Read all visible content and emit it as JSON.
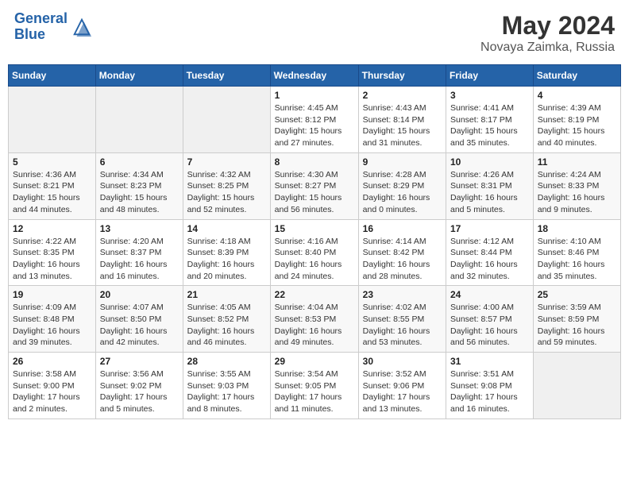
{
  "header": {
    "logo_line1": "General",
    "logo_line2": "Blue",
    "month_year": "May 2024",
    "location": "Novaya Zaimka, Russia"
  },
  "days_of_week": [
    "Sunday",
    "Monday",
    "Tuesday",
    "Wednesday",
    "Thursday",
    "Friday",
    "Saturday"
  ],
  "weeks": [
    [
      {
        "num": "",
        "info": ""
      },
      {
        "num": "",
        "info": ""
      },
      {
        "num": "",
        "info": ""
      },
      {
        "num": "1",
        "info": "Sunrise: 4:45 AM\nSunset: 8:12 PM\nDaylight: 15 hours and 27 minutes."
      },
      {
        "num": "2",
        "info": "Sunrise: 4:43 AM\nSunset: 8:14 PM\nDaylight: 15 hours and 31 minutes."
      },
      {
        "num": "3",
        "info": "Sunrise: 4:41 AM\nSunset: 8:17 PM\nDaylight: 15 hours and 35 minutes."
      },
      {
        "num": "4",
        "info": "Sunrise: 4:39 AM\nSunset: 8:19 PM\nDaylight: 15 hours and 40 minutes."
      }
    ],
    [
      {
        "num": "5",
        "info": "Sunrise: 4:36 AM\nSunset: 8:21 PM\nDaylight: 15 hours and 44 minutes."
      },
      {
        "num": "6",
        "info": "Sunrise: 4:34 AM\nSunset: 8:23 PM\nDaylight: 15 hours and 48 minutes."
      },
      {
        "num": "7",
        "info": "Sunrise: 4:32 AM\nSunset: 8:25 PM\nDaylight: 15 hours and 52 minutes."
      },
      {
        "num": "8",
        "info": "Sunrise: 4:30 AM\nSunset: 8:27 PM\nDaylight: 15 hours and 56 minutes."
      },
      {
        "num": "9",
        "info": "Sunrise: 4:28 AM\nSunset: 8:29 PM\nDaylight: 16 hours and 0 minutes."
      },
      {
        "num": "10",
        "info": "Sunrise: 4:26 AM\nSunset: 8:31 PM\nDaylight: 16 hours and 5 minutes."
      },
      {
        "num": "11",
        "info": "Sunrise: 4:24 AM\nSunset: 8:33 PM\nDaylight: 16 hours and 9 minutes."
      }
    ],
    [
      {
        "num": "12",
        "info": "Sunrise: 4:22 AM\nSunset: 8:35 PM\nDaylight: 16 hours and 13 minutes."
      },
      {
        "num": "13",
        "info": "Sunrise: 4:20 AM\nSunset: 8:37 PM\nDaylight: 16 hours and 16 minutes."
      },
      {
        "num": "14",
        "info": "Sunrise: 4:18 AM\nSunset: 8:39 PM\nDaylight: 16 hours and 20 minutes."
      },
      {
        "num": "15",
        "info": "Sunrise: 4:16 AM\nSunset: 8:40 PM\nDaylight: 16 hours and 24 minutes."
      },
      {
        "num": "16",
        "info": "Sunrise: 4:14 AM\nSunset: 8:42 PM\nDaylight: 16 hours and 28 minutes."
      },
      {
        "num": "17",
        "info": "Sunrise: 4:12 AM\nSunset: 8:44 PM\nDaylight: 16 hours and 32 minutes."
      },
      {
        "num": "18",
        "info": "Sunrise: 4:10 AM\nSunset: 8:46 PM\nDaylight: 16 hours and 35 minutes."
      }
    ],
    [
      {
        "num": "19",
        "info": "Sunrise: 4:09 AM\nSunset: 8:48 PM\nDaylight: 16 hours and 39 minutes."
      },
      {
        "num": "20",
        "info": "Sunrise: 4:07 AM\nSunset: 8:50 PM\nDaylight: 16 hours and 42 minutes."
      },
      {
        "num": "21",
        "info": "Sunrise: 4:05 AM\nSunset: 8:52 PM\nDaylight: 16 hours and 46 minutes."
      },
      {
        "num": "22",
        "info": "Sunrise: 4:04 AM\nSunset: 8:53 PM\nDaylight: 16 hours and 49 minutes."
      },
      {
        "num": "23",
        "info": "Sunrise: 4:02 AM\nSunset: 8:55 PM\nDaylight: 16 hours and 53 minutes."
      },
      {
        "num": "24",
        "info": "Sunrise: 4:00 AM\nSunset: 8:57 PM\nDaylight: 16 hours and 56 minutes."
      },
      {
        "num": "25",
        "info": "Sunrise: 3:59 AM\nSunset: 8:59 PM\nDaylight: 16 hours and 59 minutes."
      }
    ],
    [
      {
        "num": "26",
        "info": "Sunrise: 3:58 AM\nSunset: 9:00 PM\nDaylight: 17 hours and 2 minutes."
      },
      {
        "num": "27",
        "info": "Sunrise: 3:56 AM\nSunset: 9:02 PM\nDaylight: 17 hours and 5 minutes."
      },
      {
        "num": "28",
        "info": "Sunrise: 3:55 AM\nSunset: 9:03 PM\nDaylight: 17 hours and 8 minutes."
      },
      {
        "num": "29",
        "info": "Sunrise: 3:54 AM\nSunset: 9:05 PM\nDaylight: 17 hours and 11 minutes."
      },
      {
        "num": "30",
        "info": "Sunrise: 3:52 AM\nSunset: 9:06 PM\nDaylight: 17 hours and 13 minutes."
      },
      {
        "num": "31",
        "info": "Sunrise: 3:51 AM\nSunset: 9:08 PM\nDaylight: 17 hours and 16 minutes."
      },
      {
        "num": "",
        "info": ""
      }
    ]
  ]
}
